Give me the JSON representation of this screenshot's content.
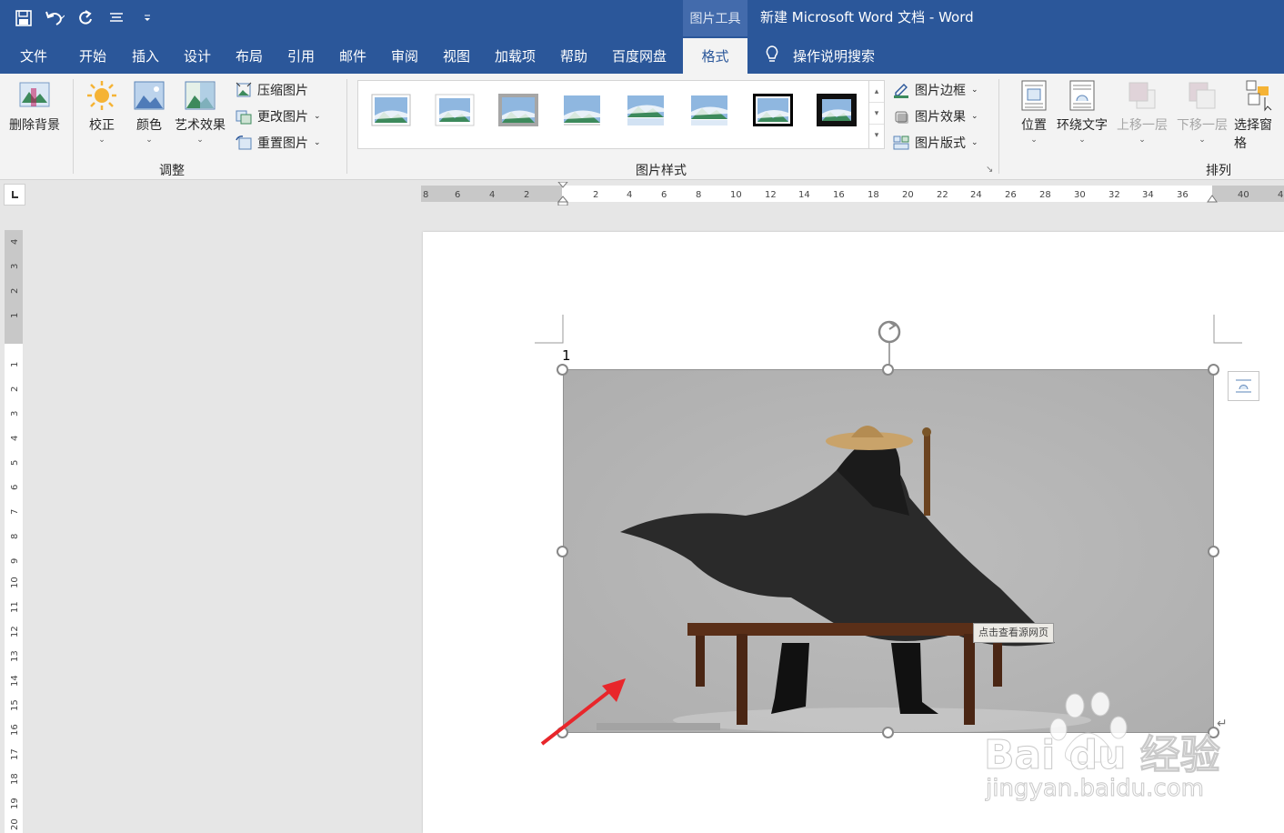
{
  "titlebar": {
    "context_tab": "图片工具",
    "document_title": "新建 Microsoft Word 文档  -  Word"
  },
  "menu": {
    "tabs": [
      "文件",
      "开始",
      "插入",
      "设计",
      "布局",
      "引用",
      "邮件",
      "审阅",
      "视图",
      "加载项",
      "帮助",
      "百度网盘"
    ],
    "active_tab": "格式",
    "tell_me": "操作说明搜索"
  },
  "ribbon": {
    "adjust": {
      "remove_bg": "删除背景",
      "corrections": "校正",
      "color": "颜色",
      "artistic": "艺术效果",
      "compress": "压缩图片",
      "change": "更改图片",
      "reset": "重置图片",
      "group_label": "调整"
    },
    "styles": {
      "border": "图片边框",
      "effects": "图片效果",
      "layout": "图片版式",
      "group_label": "图片样式"
    },
    "arrange": {
      "position": "位置",
      "wrap_text": "环绕文字",
      "bring_forward": "上移一层",
      "send_backward": "下移一层",
      "selection_pane": "选择窗格",
      "group_label": "排列"
    }
  },
  "rulers": {
    "horizontal_labels": [
      "8",
      "6",
      "4",
      "2",
      "2",
      "4",
      "6",
      "8",
      "10",
      "12",
      "14",
      "16",
      "18",
      "20",
      "22",
      "24",
      "26",
      "28",
      "30",
      "32",
      "34",
      "36",
      "40",
      "4"
    ],
    "vertical_labels": [
      "4",
      "3",
      "2",
      "1",
      "1",
      "2",
      "3",
      "4",
      "5",
      "6",
      "7",
      "8",
      "9",
      "10",
      "11",
      "12",
      "13",
      "14",
      "15",
      "16",
      "17",
      "18",
      "19",
      "20"
    ]
  },
  "document": {
    "anchor_number": "1",
    "image_tooltip": "点击查看源网页"
  },
  "watermark": {
    "brand": "Bai du 经验",
    "url": "jingyan.baidu.com"
  },
  "colors": {
    "word_blue": "#2b579a",
    "ribbon_bg": "#f3f3f3",
    "arrow": "#e8262b"
  }
}
